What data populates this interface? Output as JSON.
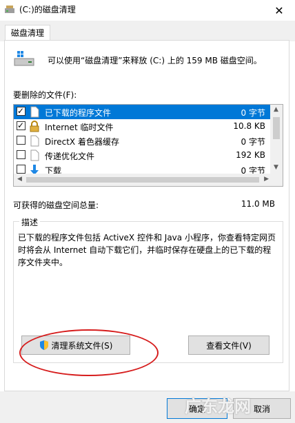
{
  "window": {
    "title": "(C:)的磁盘清理",
    "close_glyph": "✕"
  },
  "tabs": [
    {
      "label": "磁盘清理"
    }
  ],
  "intro_text": "可以使用“磁盘清理”来释放  (C:) 上的 159 MB 磁盘空间。",
  "files_label": "要删除的文件(F):",
  "files": [
    {
      "name": "已下载的程序文件",
      "size": "0 字节",
      "checked": true,
      "selected": true,
      "icon": "blank-file-icon"
    },
    {
      "name": "Internet 临时文件",
      "size": "10.8 KB",
      "checked": true,
      "selected": false,
      "icon": "lock-icon"
    },
    {
      "name": "DirectX 着色器缓存",
      "size": "0 字节",
      "checked": false,
      "selected": false,
      "icon": "blank-file-icon"
    },
    {
      "name": "传递优化文件",
      "size": "192 KB",
      "checked": false,
      "selected": false,
      "icon": "blank-file-icon"
    },
    {
      "name": "下载",
      "size": "0 字节",
      "checked": false,
      "selected": false,
      "icon": "download-arrow-icon"
    }
  ],
  "total_label": "可获得的磁盘空间总量:",
  "total_value": "11.0 MB",
  "description": {
    "title": "描述",
    "text": "已下载的程序文件包括 ActiveX 控件和 Java 小程序，你查看特定网页时将会从 Internet 自动下载它们，并临时保存在硬盘上的已下载的程序文件夹中。"
  },
  "buttons": {
    "cleanup_system": "清理系统文件(S)",
    "view_files": "查看文件(V)",
    "ok": "确定",
    "cancel": "取消"
  },
  "watermark": "广东龙网",
  "colors": {
    "selection": "#0078d7",
    "highlight_ellipse": "#d61c1c"
  }
}
